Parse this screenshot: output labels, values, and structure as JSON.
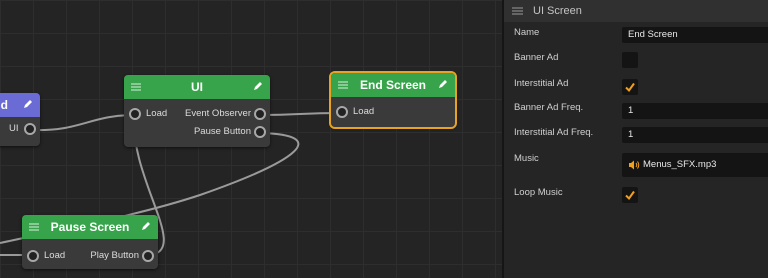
{
  "graph": {
    "nodes": {
      "left_node": {
        "title": "d",
        "ports": {
          "ui_out": "UI"
        }
      },
      "ui_node": {
        "title": "UI",
        "ports": {
          "load": "Load",
          "event_observer": "Event Observer",
          "pause_button": "Pause Button"
        }
      },
      "end_screen_node": {
        "title": "End Screen",
        "ports": {
          "load": "Load"
        }
      },
      "pause_screen_node": {
        "title": "Pause Screen",
        "ports": {
          "load": "Load",
          "play_button": "Play Button"
        }
      }
    }
  },
  "inspector": {
    "title": "UI Screen",
    "properties": {
      "name": {
        "label": "Name",
        "value": "End Screen"
      },
      "banner_ad": {
        "label": "Banner Ad",
        "checked": false
      },
      "interstitial_ad": {
        "label": "Interstitial Ad",
        "checked": true
      },
      "banner_ad_freq": {
        "label": "Banner Ad Freq.",
        "value": "1"
      },
      "interstitial_ad_freq": {
        "label": "Interstitial Ad Freq.",
        "value": "1"
      },
      "music": {
        "label": "Music",
        "value": "Menus_SFX.mp3",
        "icon": "speaker-icon"
      },
      "loop_music": {
        "label": "Loop Music",
        "checked": true
      }
    }
  },
  "colors": {
    "node_header_green": "#37a34a",
    "node_header_purple": "#6b6bd6",
    "selection_accent": "#e8a323",
    "checkmark": "#f0a020"
  }
}
